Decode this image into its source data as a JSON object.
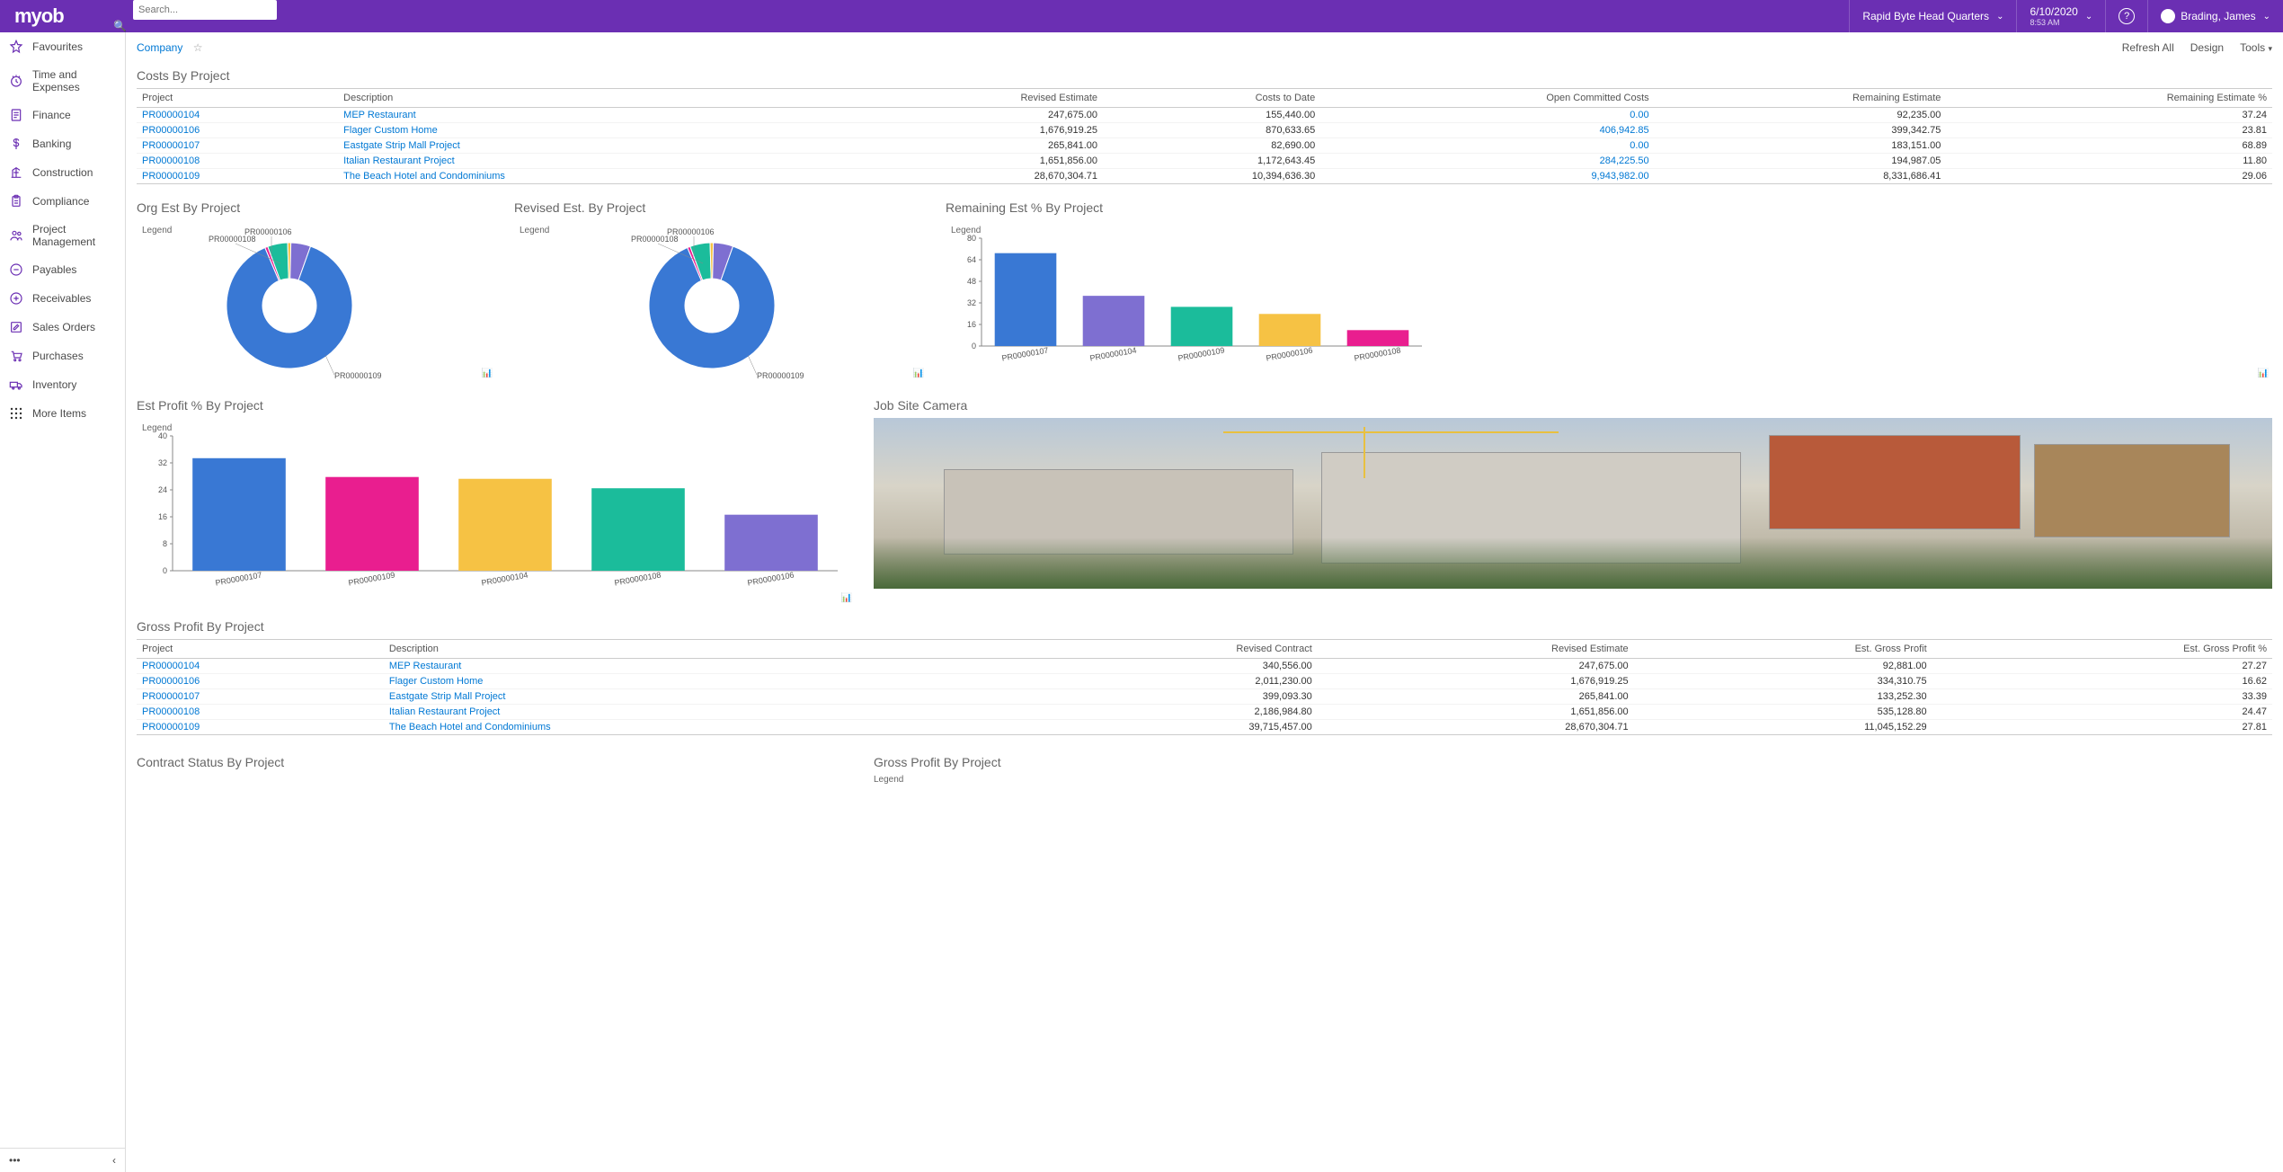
{
  "header": {
    "logo": "myob",
    "search_placeholder": "Search...",
    "company": "Rapid Byte Head Quarters",
    "date": "6/10/2020",
    "time": "8:53 AM",
    "user": "Brading, James"
  },
  "sidebar": {
    "items": [
      {
        "label": "Favourites",
        "icon": "star"
      },
      {
        "label": "Time and Expenses",
        "icon": "clock"
      },
      {
        "label": "Finance",
        "icon": "doc"
      },
      {
        "label": "Banking",
        "icon": "dollar"
      },
      {
        "label": "Construction",
        "icon": "crane"
      },
      {
        "label": "Compliance",
        "icon": "clip"
      },
      {
        "label": "Project Management",
        "icon": "people"
      },
      {
        "label": "Payables",
        "icon": "minus"
      },
      {
        "label": "Receivables",
        "icon": "plus"
      },
      {
        "label": "Sales Orders",
        "icon": "pencil"
      },
      {
        "label": "Purchases",
        "icon": "cart"
      },
      {
        "label": "Inventory",
        "icon": "truck"
      }
    ],
    "more": "More Items"
  },
  "breadcrumb": "Company",
  "top_actions": {
    "refresh": "Refresh All",
    "design": "Design",
    "tools": "Tools"
  },
  "costs_table": {
    "title": "Costs By Project",
    "headers": [
      "Project",
      "Description",
      "Revised Estimate",
      "Costs to Date",
      "Open Committed Costs",
      "Remaining Estimate",
      "Remaining Estimate %"
    ],
    "rows": [
      {
        "project": "PR00000104",
        "desc": "MEP Restaurant",
        "revised": "247,675.00",
        "costs": "155,440.00",
        "open": "0.00",
        "open_link": true,
        "rem": "92,235.00",
        "pct": "37.24"
      },
      {
        "project": "PR00000106",
        "desc": "Flager Custom Home",
        "revised": "1,676,919.25",
        "costs": "870,633.65",
        "open": "406,942.85",
        "open_link": true,
        "rem": "399,342.75",
        "pct": "23.81"
      },
      {
        "project": "PR00000107",
        "desc": "Eastgate Strip Mall Project",
        "revised": "265,841.00",
        "costs": "82,690.00",
        "open": "0.00",
        "open_link": true,
        "rem": "183,151.00",
        "pct": "68.89"
      },
      {
        "project": "PR00000108",
        "desc": "Italian Restaurant Project",
        "revised": "1,651,856.00",
        "costs": "1,172,643.45",
        "open": "284,225.50",
        "open_link": true,
        "rem": "194,987.05",
        "pct": "11.80"
      },
      {
        "project": "PR00000109",
        "desc": "The Beach Hotel and Condominiums",
        "revised": "28,670,304.71",
        "costs": "10,394,636.30",
        "open": "9,943,982.00",
        "open_link": true,
        "rem": "8,331,686.41",
        "pct": "29.06"
      }
    ]
  },
  "charts": {
    "org_title": "Org Est By Project",
    "rev_title": "Revised Est. By Project",
    "remaining_title": "Remaining Est % By Project",
    "profit_title": "Est Profit % By Project",
    "camera_title": "Job Site Camera",
    "legend_label": "Legend"
  },
  "gross_table": {
    "title": "Gross Profit By Project",
    "headers": [
      "Project",
      "Description",
      "Revised Contract",
      "Revised Estimate",
      "Est. Gross Profit",
      "Est. Gross Profit %"
    ],
    "rows": [
      {
        "project": "PR00000104",
        "desc": "MEP Restaurant",
        "rc": "340,556.00",
        "re": "247,675.00",
        "gp": "92,881.00",
        "pct": "27.27"
      },
      {
        "project": "PR00000106",
        "desc": "Flager Custom Home",
        "rc": "2,011,230.00",
        "re": "1,676,919.25",
        "gp": "334,310.75",
        "pct": "16.62"
      },
      {
        "project": "PR00000107",
        "desc": "Eastgate Strip Mall Project",
        "rc": "399,093.30",
        "re": "265,841.00",
        "gp": "133,252.30",
        "pct": "33.39"
      },
      {
        "project": "PR00000108",
        "desc": "Italian Restaurant Project",
        "rc": "2,186,984.80",
        "re": "1,651,856.00",
        "gp": "535,128.80",
        "pct": "24.47"
      },
      {
        "project": "PR00000109",
        "desc": "The Beach Hotel and Condominiums",
        "rc": "39,715,457.00",
        "re": "28,670,304.71",
        "gp": "11,045,152.29",
        "pct": "27.81"
      }
    ]
  },
  "bottom": {
    "contract_title": "Contract Status By Project",
    "gross_title": "Gross Profit By Project"
  },
  "chart_data": [
    {
      "id": "org_est_by_project",
      "type": "pie",
      "title": "Org Est By Project",
      "labels_visible": [
        "PR00000106",
        "PR00000108",
        "PR00000109"
      ],
      "series": [
        {
          "name": "PR00000104",
          "value": 247675.0,
          "color": "#e91e8f"
        },
        {
          "name": "PR00000106",
          "value": 1676919.25,
          "color": "#1bbc9b"
        },
        {
          "name": "PR00000107",
          "value": 265841.0,
          "color": "#f6c244"
        },
        {
          "name": "PR00000108",
          "value": 1651856.0,
          "color": "#7e6fd1"
        },
        {
          "name": "PR00000109",
          "value": 28670304.71,
          "color": "#3978d4"
        }
      ]
    },
    {
      "id": "revised_est_by_project",
      "type": "pie",
      "title": "Revised Est. By Project",
      "labels_visible": [
        "PR00000106",
        "PR00000108",
        "PR00000109"
      ],
      "series": [
        {
          "name": "PR00000104",
          "value": 247675.0,
          "color": "#e91e8f"
        },
        {
          "name": "PR00000106",
          "value": 1676919.25,
          "color": "#1bbc9b"
        },
        {
          "name": "PR00000107",
          "value": 265841.0,
          "color": "#f6c244"
        },
        {
          "name": "PR00000108",
          "value": 1651856.0,
          "color": "#7e6fd1"
        },
        {
          "name": "PR00000109",
          "value": 28670304.71,
          "color": "#3978d4"
        }
      ]
    },
    {
      "id": "remaining_est_pct_by_project",
      "type": "bar",
      "title": "Remaining Est % By Project",
      "ylabel": "",
      "xlabel": "",
      "ylim": [
        0,
        80
      ],
      "categories": [
        "PR00000107",
        "PR00000104",
        "PR00000109",
        "PR00000106",
        "PR00000108"
      ],
      "values": [
        68.89,
        37.24,
        29.06,
        23.81,
        11.8
      ],
      "colors": [
        "#3978d4",
        "#7e6fd1",
        "#1bbc9b",
        "#f6c244",
        "#e91e8f"
      ]
    },
    {
      "id": "est_profit_pct_by_project",
      "type": "bar",
      "title": "Est Profit % By Project",
      "ylabel": "",
      "xlabel": "",
      "ylim": [
        0,
        40
      ],
      "categories": [
        "PR00000107",
        "PR00000109",
        "PR00000104",
        "PR00000108",
        "PR00000106"
      ],
      "values": [
        33.39,
        27.81,
        27.27,
        24.47,
        16.62
      ],
      "colors": [
        "#3978d4",
        "#e91e8f",
        "#f6c244",
        "#1bbc9b",
        "#7e6fd1"
      ]
    }
  ]
}
